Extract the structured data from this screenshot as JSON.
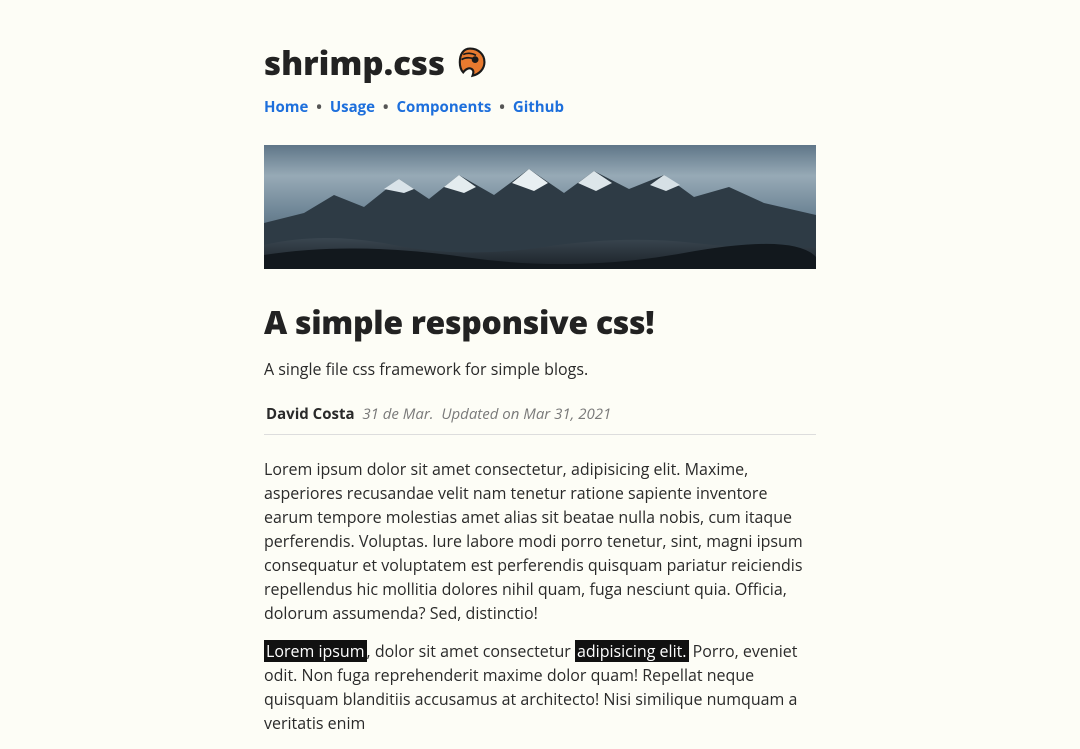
{
  "header": {
    "title": "shrimp.css"
  },
  "nav": {
    "items": [
      "Home",
      "Usage",
      "Components",
      "Github"
    ],
    "separator": "•"
  },
  "article": {
    "headline": "A simple responsive css!",
    "tagline": "A single file css framework for simple blogs.",
    "author": "David Costa",
    "date": "31 de Mar.",
    "updated": "Updated on Mar 31, 2021",
    "para1": "Lorem ipsum dolor sit amet consectetur, adipisicing elit. Maxime, asperiores recusandae velit nam tenetur ratione sapiente inventore earum tempore molestias amet alias sit beatae nulla nobis, cum itaque perferendis. Voluptas. Iure labore modi porro tenetur, sint, magni ipsum consequatur et voluptatem est perferendis quisquam pariatur reiciendis repellendus hic mollitia dolores nihil quam, fuga nesciunt quia. Officia, dolorum assumenda? Sed, distinctio!",
    "para2": {
      "hl1": "Lorem ipsum",
      "seg1": ", dolor sit amet consectetur ",
      "hl2": "adipisicing elit.",
      "seg2": " Porro, eveniet odit. Non fuga reprehenderit maxime dolor quam! Repellat neque quisquam blanditiis accusamus at architecto! Nisi similique numquam a veritatis enim"
    }
  }
}
